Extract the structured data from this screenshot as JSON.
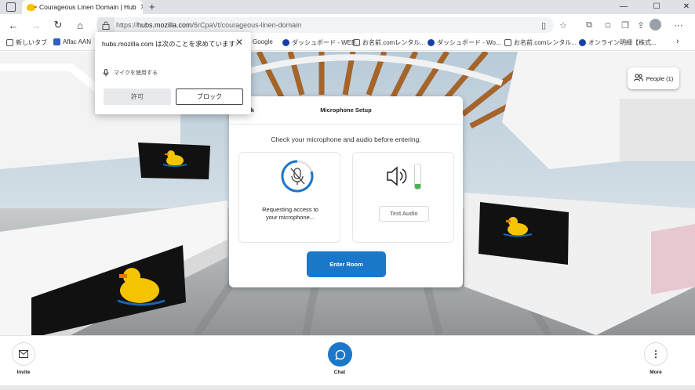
{
  "browser": {
    "tab_title": "Courageous Linen Domain | Hub",
    "tab_close": "✕",
    "new_tab": "+",
    "url_prefix": "https://",
    "url_host": "hubs.mozilla.com",
    "url_path": "/6rCpaVt/courageous-linen-domain",
    "window_controls": [
      "—",
      "☐",
      "✕"
    ]
  },
  "bookmarks": [
    {
      "label": "新しいタブ",
      "color": "#8ab4f8"
    },
    {
      "label": "Aflac AAN",
      "color": "#2f5ec4"
    },
    {
      "label": "Google",
      "color": "#ffffff"
    },
    {
      "label": "ダッシュボード - WEB...",
      "color": "#1a3fa8"
    },
    {
      "label": "お名前.comレンタル...",
      "color": "#555555"
    },
    {
      "label": "ダッシュボード - Wo...",
      "color": "#1a3fa8"
    },
    {
      "label": "お名前.comレンタル...",
      "color": "#555555"
    },
    {
      "label": "オンライン明細【株式...",
      "color": "#1a3fa8"
    }
  ],
  "permission": {
    "title": "hubs.mozilla.com は次のことを求めています:",
    "item": "マイクを使用する",
    "allow": "許可",
    "block": "ブロック",
    "close": "✕"
  },
  "people_button": "People (1)",
  "modal": {
    "back": "Back",
    "title": "Microphone Setup",
    "prompt": "Check your microphone and audio before entering.",
    "mic_status_line1": "Requesting access to",
    "mic_status_line2": "your microphone...",
    "test_audio": "Test Audio",
    "enter_room": "Enter Room"
  },
  "bottom_bar": {
    "invite": "Invite",
    "chat": "Chat",
    "more": "More"
  },
  "colors": {
    "accent": "#1a77c9",
    "level_meter": "#45b649"
  }
}
